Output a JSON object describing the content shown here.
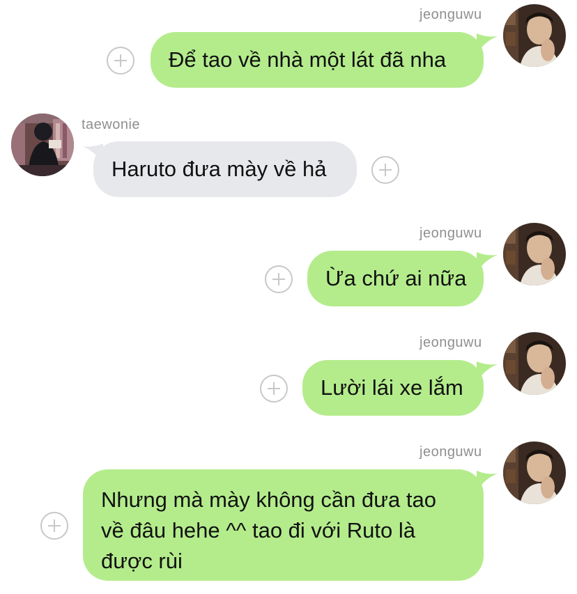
{
  "messages": [
    {
      "sender": "jeonguwu",
      "text": "Để tao về nhà một lát đã nha"
    },
    {
      "sender": "taewonie",
      "text": "Haruto đưa mày về hả"
    },
    {
      "sender": "jeonguwu",
      "text": "Ừa chứ ai nữa"
    },
    {
      "sender": "jeonguwu",
      "text": "Lười lái xe lắm"
    },
    {
      "sender": "jeonguwu",
      "text": "Nhưng mà mày không cần đưa tao về đâu hehe ^^ tao đi với Ruto là được rùi"
    }
  ],
  "colors": {
    "outgoing_bubble": "#b4ec8c",
    "incoming_bubble": "#e7e8ec",
    "username": "#8f8f8f",
    "plus_icon": "#c8c8c8"
  },
  "icons": {
    "react": "plus-icon",
    "avatar_jeonguwu": "avatar-photo",
    "avatar_taewonie": "avatar-photo"
  }
}
